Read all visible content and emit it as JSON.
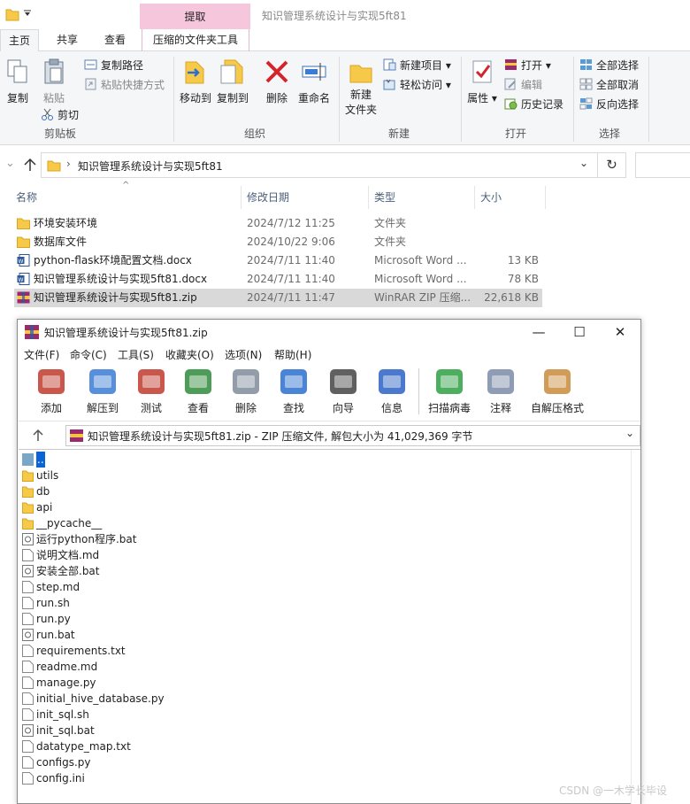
{
  "explorer": {
    "context_tab": "提取",
    "title": "知识管理系统设计与实现5ft81",
    "tabs": [
      "主页",
      "共享",
      "查看",
      "压缩的文件夹工具"
    ],
    "clipboard": {
      "copy": "复制",
      "paste": "粘贴",
      "copy_path": "复制路径",
      "paste_shortcut": "粘贴快捷方式",
      "cut": "剪切",
      "group_label": "剪贴板"
    },
    "organize": {
      "move_to": "移动到",
      "copy_to": "复制到",
      "delete": "删除",
      "rename": "重命名",
      "group_label": "组织"
    },
    "new": {
      "new_folder_l1": "新建",
      "new_folder_l2": "文件夹",
      "new_item": "新建项目",
      "easy_access": "轻松访问",
      "group_label": "新建"
    },
    "open": {
      "properties": "属性",
      "open": "打开",
      "edit": "编辑",
      "history": "历史记录",
      "group_label": "打开"
    },
    "select": {
      "select_all": "全部选择",
      "select_none": "全部取消",
      "invert": "反向选择",
      "group_label": "选择"
    },
    "address": "知识管理系统设计与实现5ft81",
    "columns": {
      "name": "名称",
      "date": "修改日期",
      "type": "类型",
      "size": "大小"
    },
    "files": [
      {
        "name": "环境安装环境",
        "date": "2024/7/12 11:25",
        "type": "文件夹",
        "size": "",
        "kind": "folder"
      },
      {
        "name": "数据库文件",
        "date": "2024/10/22 9:06",
        "type": "文件夹",
        "size": "",
        "kind": "folder"
      },
      {
        "name": "python-flask环境配置文档.docx",
        "date": "2024/7/11 11:40",
        "type": "Microsoft Word ...",
        "size": "13 KB",
        "kind": "word"
      },
      {
        "name": "知识管理系统设计与实现5ft81.docx",
        "date": "2024/7/11 11:40",
        "type": "Microsoft Word ...",
        "size": "78 KB",
        "kind": "word"
      },
      {
        "name": "知识管理系统设计与实现5ft81.zip",
        "date": "2024/7/11 11:47",
        "type": "WinRAR ZIP 压缩...",
        "size": "22,618 KB",
        "kind": "zip",
        "selected": true
      }
    ]
  },
  "winrar": {
    "title": "知识管理系统设计与实现5ft81.zip",
    "menu": [
      "文件(F)",
      "命令(C)",
      "工具(S)",
      "收藏夹(O)",
      "选项(N)",
      "帮助(H)"
    ],
    "toolbar": [
      {
        "label": "添加",
        "icon": "add-archive-icon",
        "color": "#c0392b"
      },
      {
        "label": "解压到",
        "icon": "extract-to-icon",
        "color": "#3a7bd5"
      },
      {
        "label": "测试",
        "icon": "test-icon",
        "color": "#c0392b"
      },
      {
        "label": "查看",
        "icon": "view-book-icon",
        "color": "#2e8b3a"
      },
      {
        "label": "删除",
        "icon": "trash-icon",
        "color": "#7f8c9a"
      },
      {
        "label": "查找",
        "icon": "find-magnifier-icon",
        "color": "#2a6fd0"
      },
      {
        "label": "向导",
        "icon": "wizard-wand-icon",
        "color": "#444444"
      },
      {
        "label": "信息",
        "icon": "info-icon",
        "color": "#2a62c4"
      },
      {
        "label": "扫描病毒",
        "icon": "virus-scan-icon",
        "color": "#2ea043"
      },
      {
        "label": "注释",
        "icon": "comment-icon",
        "color": "#7a8ca8"
      },
      {
        "label": "自解压格式",
        "icon": "sfx-box-icon",
        "color": "#c98b3a"
      }
    ],
    "path": "知识管理系统设计与实现5ft81.zip - ZIP 压缩文件, 解包大小为 41,029,369 字节",
    "entries": [
      {
        "name": "..",
        "kind": "up"
      },
      {
        "name": "utils",
        "kind": "folder"
      },
      {
        "name": "db",
        "kind": "folder"
      },
      {
        "name": "api",
        "kind": "folder"
      },
      {
        "name": "__pycache__",
        "kind": "folder"
      },
      {
        "name": "运行python程序.bat",
        "kind": "bat"
      },
      {
        "name": "说明文档.md",
        "kind": "file"
      },
      {
        "name": "安装全部.bat",
        "kind": "bat"
      },
      {
        "name": "step.md",
        "kind": "file"
      },
      {
        "name": "run.sh",
        "kind": "file"
      },
      {
        "name": "run.py",
        "kind": "file"
      },
      {
        "name": "run.bat",
        "kind": "bat"
      },
      {
        "name": "requirements.txt",
        "kind": "file"
      },
      {
        "name": "readme.md",
        "kind": "file"
      },
      {
        "name": "manage.py",
        "kind": "file"
      },
      {
        "name": "initial_hive_database.py",
        "kind": "file"
      },
      {
        "name": "init_sql.sh",
        "kind": "file"
      },
      {
        "name": "init_sql.bat",
        "kind": "bat"
      },
      {
        "name": "datatype_map.txt",
        "kind": "file"
      },
      {
        "name": "configs.py",
        "kind": "file"
      },
      {
        "name": "config.ini",
        "kind": "file"
      }
    ]
  },
  "watermark": "CSDN @一木学长毕设",
  "colors": {
    "folder": "#f7c948",
    "selected_row": "#d9d9d9",
    "context_tab": "#f6c6dc",
    "ribbon_bg": "#f5f6f7"
  }
}
